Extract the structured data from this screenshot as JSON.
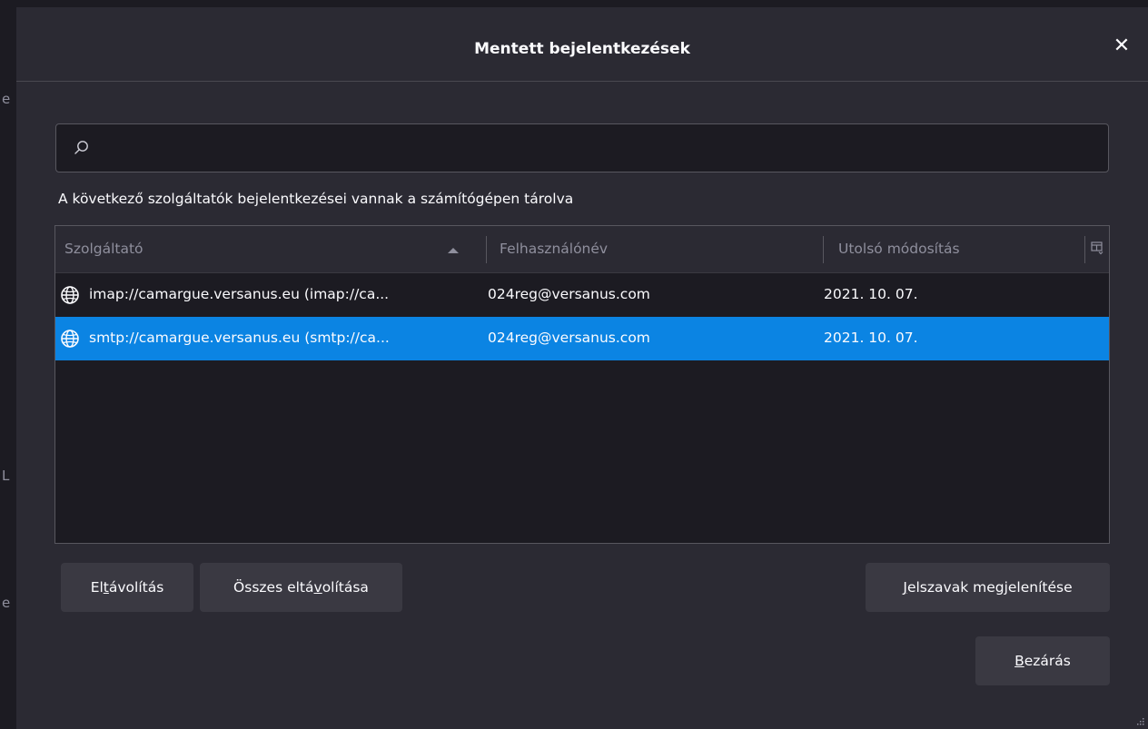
{
  "dialog": {
    "title": "Mentett bejelentkezések",
    "close_glyph": "✕",
    "search_placeholder": "",
    "description": "A következő szolgáltatók bejelentkezései vannak a számítógépen tárolva"
  },
  "table": {
    "columns": [
      "Szolgáltató",
      "Felhasználónév",
      "Utolsó módosítás"
    ],
    "sorted_column": "Szolgáltató",
    "sort_direction": "ascending",
    "rows": [
      {
        "provider": "imap://camargue.versanus.eu (imap://ca...",
        "username": "024reg@versanus.com",
        "modified": "2021. 10. 07.",
        "selected": false
      },
      {
        "provider": "smtp://camargue.versanus.eu (smtp://ca...",
        "username": "024reg@versanus.com",
        "modified": "2021. 10. 07.",
        "selected": true
      }
    ]
  },
  "buttons": {
    "remove": {
      "pre": "El",
      "key": "t",
      "post": "ávolítás"
    },
    "remove_all": {
      "pre": "Összes eltá",
      "key": "v",
      "post": "olítása"
    },
    "show_passwords": {
      "pre": "",
      "key": "J",
      "post": "elszavak megjelenítése"
    },
    "close": {
      "pre": "",
      "key": "B",
      "post": "ezárás"
    }
  },
  "colors": {
    "dialog_bg": "#2b2a33",
    "field_bg": "#1c1b22",
    "selection": "#0b84e3",
    "button_bg": "#3a3942",
    "muted_text": "#8f8f9d"
  },
  "icons": [
    "search-icon",
    "globe-icon",
    "close-icon",
    "column-picker-icon",
    "sort-ascending-icon",
    "resize-grip-icon"
  ]
}
